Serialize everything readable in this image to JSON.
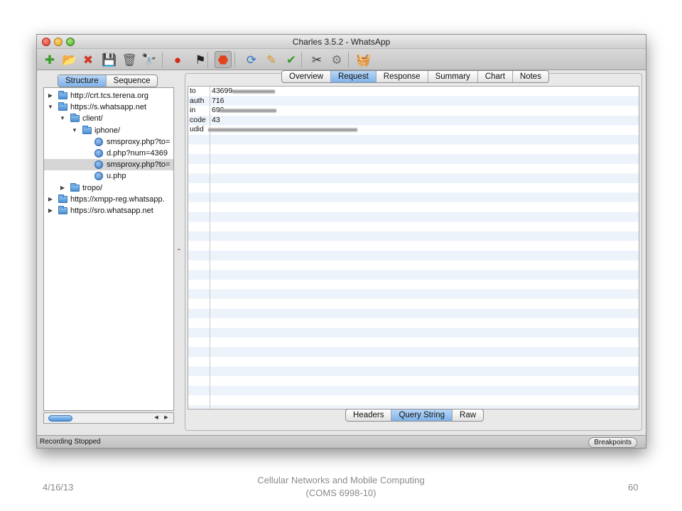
{
  "window": {
    "title": "Charles 3.5.2 - WhatsApp"
  },
  "toolbar": {
    "buttons": [
      {
        "name": "new-session-icon",
        "glyph": "✚",
        "color": "#3a9a2a"
      },
      {
        "name": "open-session-icon",
        "glyph": "📂",
        "color": "#3b7fc4"
      },
      {
        "name": "close-session-icon",
        "glyph": "✖",
        "color": "#d03a2a"
      },
      {
        "name": "save-icon",
        "glyph": "💾",
        "color": "#333333"
      },
      {
        "name": "trash-icon",
        "glyph": "🗑",
        "color": "#555555"
      },
      {
        "name": "binoculars-icon",
        "glyph": "🔭",
        "color": "#222222"
      },
      {
        "name": "record-icon",
        "glyph": "●",
        "color": "#d12a1a"
      },
      {
        "name": "throttle-flag-icon",
        "glyph": "⚑",
        "color": "#222222"
      },
      {
        "name": "stop-breakpoints-icon",
        "glyph": "⬣",
        "color": "#e0431e"
      },
      {
        "name": "refresh-icon",
        "glyph": "⟳",
        "color": "#2f78c4"
      },
      {
        "name": "edit-pencil-icon",
        "glyph": "✎",
        "color": "#d7962a"
      },
      {
        "name": "validate-check-icon",
        "glyph": "✔",
        "color": "#3b9a2a"
      },
      {
        "name": "tools-icon",
        "glyph": "✂",
        "color": "#333333"
      },
      {
        "name": "settings-gear-icon",
        "glyph": "⚙",
        "color": "#777777"
      },
      {
        "name": "shopping-basket-icon",
        "glyph": "🧺",
        "color": "#555555"
      }
    ]
  },
  "left_tabs": {
    "structure": "Structure",
    "sequence": "Sequence"
  },
  "tree": [
    {
      "label": "http://crt.tcs.terena.org",
      "indent": 0,
      "disclosure": "▶",
      "kind": "folder"
    },
    {
      "label": "https://s.whatsapp.net",
      "indent": 0,
      "disclosure": "▼",
      "kind": "folder"
    },
    {
      "label": "client/",
      "indent": 1,
      "disclosure": "▼",
      "kind": "folder"
    },
    {
      "label": "iphone/",
      "indent": 2,
      "disclosure": "▼",
      "kind": "folder"
    },
    {
      "label": "smsproxy.php?to=",
      "indent": 3,
      "disclosure": "",
      "kind": "file"
    },
    {
      "label": "d.php?num=4369",
      "indent": 3,
      "disclosure": "",
      "kind": "file"
    },
    {
      "label": "smsproxy.php?to=",
      "indent": 3,
      "disclosure": "",
      "kind": "file",
      "selected": true
    },
    {
      "label": "u.php",
      "indent": 3,
      "disclosure": "",
      "kind": "file"
    },
    {
      "label": "tropo/",
      "indent": 1,
      "disclosure": "▶",
      "kind": "folder"
    },
    {
      "label": "https://xmpp-reg.whatsapp.",
      "indent": 0,
      "disclosure": "▶",
      "kind": "folder"
    },
    {
      "label": "https://sro.whatsapp.net",
      "indent": 0,
      "disclosure": "▶",
      "kind": "folder"
    }
  ],
  "right_tabs": {
    "overview": "Overview",
    "request": "Request",
    "response": "Response",
    "summary": "Summary",
    "chart": "Chart",
    "notes": "Notes"
  },
  "query_string": [
    {
      "key": "to",
      "value": "43699",
      "redacted": true
    },
    {
      "key": "auth",
      "value": "716",
      "redacted": false
    },
    {
      "key": "in",
      "value": "699",
      "redacted": true
    },
    {
      "key": "code",
      "value": "43",
      "redacted": false
    },
    {
      "key": "udid",
      "value": "",
      "redacted": true
    }
  ],
  "bottom_tabs": {
    "headers": "Headers",
    "query_string": "Query String",
    "raw": "Raw"
  },
  "status": {
    "text": "Recording Stopped",
    "breakpoints": "Breakpoints"
  },
  "slide_footer": {
    "date": "4/16/13",
    "course_line1": "Cellular Networks and Mobile Computing",
    "course_line2": "(COMS 6998-10)",
    "page": "60"
  }
}
